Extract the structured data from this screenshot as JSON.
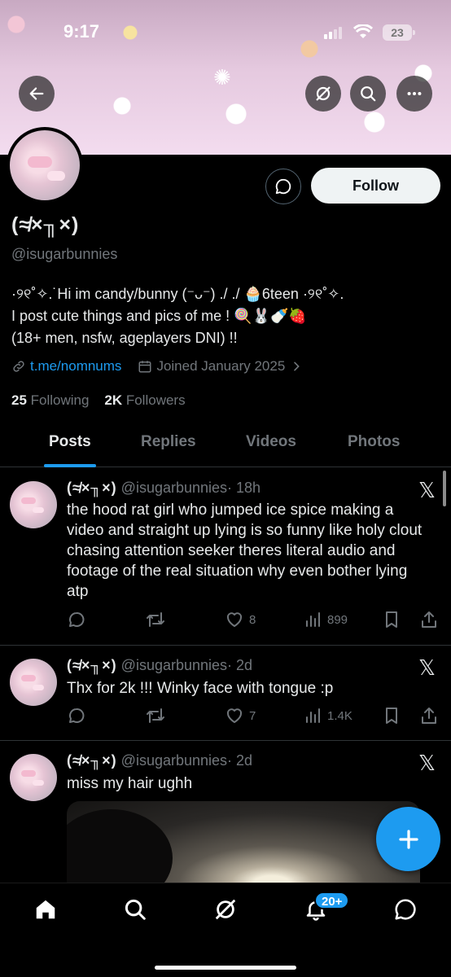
{
  "status_bar": {
    "time": "9:17",
    "battery": "23"
  },
  "profile": {
    "display_name": "(≉×╖×)",
    "handle": "@isugarbunnies",
    "follow_label": "Follow",
    "bio_lines": [
      "·୨୧˚✧.˙Hi im candy/bunny (⁻ᴗ⁻) ./ ./ 🧁6teen ·୨୧˚✧.",
      "I post cute things and pics of me ! 🍭🐰🍼🍓",
      "(18+ men, nsfw, ageplayers DNI) !!"
    ],
    "link": "t.me/nomnums",
    "joined": "Joined January 2025",
    "following_count": "25",
    "following_label": "Following",
    "followers_count": "2K",
    "followers_label": "Followers"
  },
  "tabs": [
    {
      "label": "Posts",
      "active": true
    },
    {
      "label": "Replies",
      "active": false
    },
    {
      "label": "Videos",
      "active": false
    },
    {
      "label": "Photos",
      "active": false
    }
  ],
  "posts": [
    {
      "name": "(≉×╖×)",
      "handle": "@isugarbunnies",
      "time": "· 18h",
      "text": "the hood rat girl who jumped ice spice making a video and straight up lying is so funny like holy clout chasing attention seeker theres literal audio and footage of the real situation why even bother lying atp",
      "likes": "8",
      "views": "899"
    },
    {
      "name": "(≉×╖×)",
      "handle": "@isugarbunnies",
      "time": "· 2d",
      "text": "Thx for 2k !!! Winky face with tongue :p",
      "likes": "7",
      "views": "1.4K"
    },
    {
      "name": "(≉×╖×)",
      "handle": "@isugarbunnies",
      "time": "· 2d",
      "text": "miss my hair ughh"
    }
  ],
  "notifications_badge": "20+",
  "icons": [
    "back-arrow-icon",
    "grok-icon",
    "search-icon",
    "more-icon",
    "message-icon",
    "link-icon",
    "calendar-icon",
    "chevron-right-icon",
    "x-logo-icon",
    "reply-icon",
    "retweet-icon",
    "like-icon",
    "views-icon",
    "bookmark-icon",
    "share-icon",
    "plus-icon",
    "home-icon",
    "bell-icon"
  ],
  "colors": {
    "accent": "#1d9bf0",
    "background": "#000000",
    "muted": "#71767b"
  }
}
